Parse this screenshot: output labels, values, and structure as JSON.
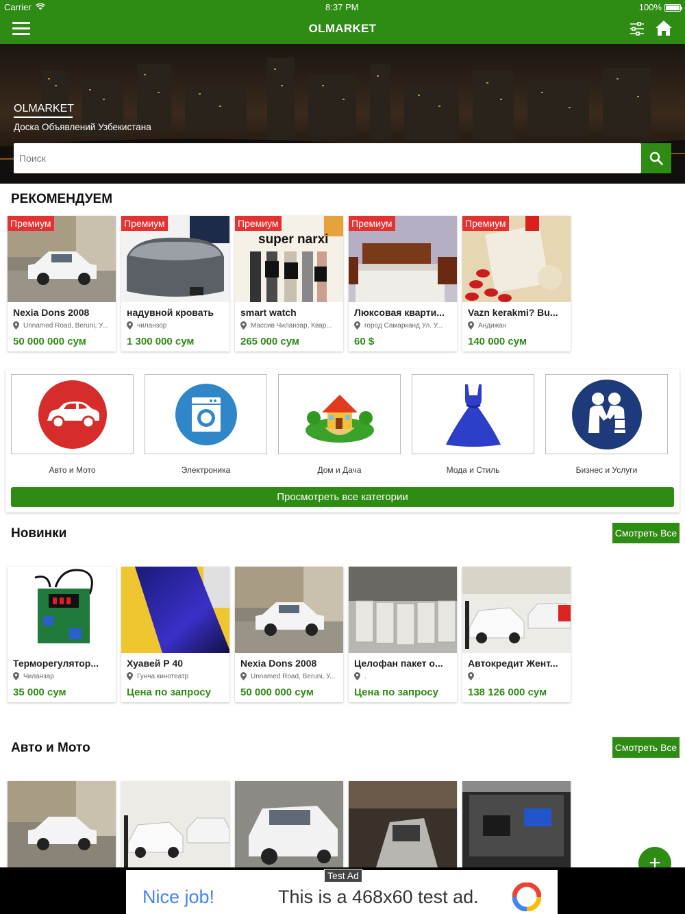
{
  "status_bar": {
    "carrier": "Carrier",
    "time": "8:37 PM",
    "battery": "100%"
  },
  "nav": {
    "title": "OLMARKET"
  },
  "hero": {
    "brand": "OLMARKET",
    "subtitle": "Доска Объявлений Узбекистана",
    "search_placeholder": "Поиск"
  },
  "recommended": {
    "title": "РЕКОМЕНДУЕМ",
    "badge": "Премиум",
    "items": [
      {
        "name": "Nexia Dons 2008",
        "location": "Unnamed Road, Beruni, У...",
        "price": "50 000 000 сум"
      },
      {
        "name": "надувной кровать",
        "location": "чиланзор",
        "price": "1 300 000 сум"
      },
      {
        "name": "smart watch",
        "location": "Массив Чиланзар, Квар...",
        "price": "265 000 сум",
        "image_text": "super narxi"
      },
      {
        "name": "Люксовая кварти...",
        "location": "город Самарканд Ул. У...",
        "price": "60 $"
      },
      {
        "name": "Vazn kerakmi? Bu...",
        "location": "Андижан",
        "price": "140 000 сум"
      }
    ]
  },
  "categories": {
    "items": [
      {
        "label": "Авто и Мото",
        "icon": "car-icon"
      },
      {
        "label": "Электроника",
        "icon": "washing-machine-icon"
      },
      {
        "label": "Дом и Дача",
        "icon": "house-icon"
      },
      {
        "label": "Мода и Стиль",
        "icon": "dress-icon"
      },
      {
        "label": "Бизнес и Услуги",
        "icon": "handshake-icon"
      }
    ],
    "view_all": "Просмотреть все категории"
  },
  "new_items": {
    "title": "Новинки",
    "see_all": "Смотреть Все",
    "items": [
      {
        "name": "Терморегулятор...",
        "location": "Чиланзар",
        "price": "35 000 сум"
      },
      {
        "name": "Хуавей Р 40",
        "location": "Гунча кинотеатр",
        "price": "Цена по запросу"
      },
      {
        "name": "Nexia Dons 2008",
        "location": "Unnamed Road, Beruni, У...",
        "price": "50 000 000 сум"
      },
      {
        "name": "Целофан пакет о...",
        "location": ".",
        "price": "Цена по запросу"
      },
      {
        "name": "Автокредит Жент...",
        "location": ".",
        "price": "138 126 000 сум"
      }
    ]
  },
  "auto_moto": {
    "title": "Авто и Мото",
    "see_all": "Смотреть Все"
  },
  "ad": {
    "tag": "Test Ad",
    "nice": "Nice job!",
    "text": "This is a 468x60 test ad."
  },
  "colors": {
    "primary": "#2e8b14",
    "premium": "#e23232",
    "price": "#2e8b14"
  }
}
